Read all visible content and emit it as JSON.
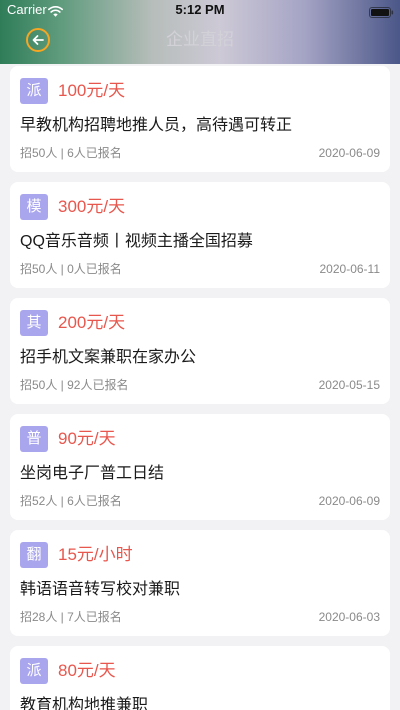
{
  "status_bar": {
    "carrier": "Carrier",
    "time": "5:12 PM",
    "wifi_icon": "wifi-icon",
    "battery_icon": "battery-icon"
  },
  "header": {
    "title": "企业直招",
    "back_icon": "back-arrow-icon"
  },
  "colors": {
    "badge_bg": "#aaa6ee",
    "salary": "#e8574d",
    "back_ring": "#f5a623",
    "page_bg": "#f2f2f5"
  },
  "jobs": [
    {
      "badge": "派",
      "salary": "100元/天",
      "title": "早教机构招聘地推人员，高待遇可转正",
      "meta": "招50人 | 6人已报名",
      "date": "2020-06-09"
    },
    {
      "badge": "模",
      "salary": "300元/天",
      "title": "QQ音乐音频丨视频主播全国招募",
      "meta": "招50人 | 0人已报名",
      "date": "2020-06-11"
    },
    {
      "badge": "其",
      "salary": "200元/天",
      "title": "招手机文案兼职在家办公",
      "meta": "招50人 | 92人已报名",
      "date": "2020-05-15"
    },
    {
      "badge": "普",
      "salary": "90元/天",
      "title": "坐岗电子厂普工日结",
      "meta": "招52人 | 6人已报名",
      "date": "2020-06-09"
    },
    {
      "badge": "翻",
      "salary": "15元/小时",
      "title": "韩语语音转写校对兼职",
      "meta": "招28人 | 7人已报名",
      "date": "2020-06-03"
    },
    {
      "badge": "派",
      "salary": "80元/天",
      "title": "教育机构地推兼职"
    }
  ]
}
